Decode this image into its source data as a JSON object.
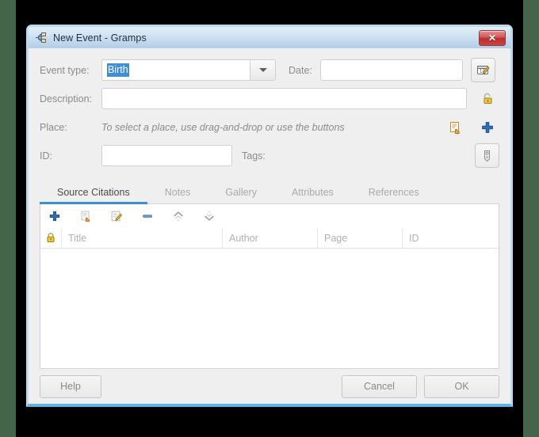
{
  "window": {
    "title": "New Event - Gramps",
    "app_icon": "gramps-family-tree-icon",
    "close_label": "✕"
  },
  "form": {
    "event_type": {
      "label": "Event type:",
      "value": "Birth",
      "selected": true,
      "dropdown_icon": "chevron-down-icon"
    },
    "date": {
      "label": "Date:",
      "value": "",
      "editor_icon": "calendar-edit-icon"
    },
    "description": {
      "label": "Description:",
      "value": "",
      "privacy_icon": "padlock-open-icon"
    },
    "place": {
      "label": "Place:",
      "hint": "To select a place, use drag-and-drop or use the buttons",
      "share_icon": "share-place-icon",
      "add_icon": "plus-icon"
    },
    "id": {
      "label": "ID:",
      "value": ""
    },
    "tags": {
      "label": "Tags:",
      "icon": "tag-icon"
    }
  },
  "notebook": {
    "tabs": [
      {
        "label": "Source Citations",
        "active": true
      },
      {
        "label": "Notes",
        "active": false
      },
      {
        "label": "Gallery",
        "active": false
      },
      {
        "label": "Attributes",
        "active": false
      },
      {
        "label": "References",
        "active": false
      }
    ],
    "toolbar": [
      {
        "name": "add-citation-icon",
        "glyph": "plus"
      },
      {
        "name": "share-citation-icon",
        "glyph": "share"
      },
      {
        "name": "edit-citation-icon",
        "glyph": "edit"
      },
      {
        "name": "remove-citation-icon",
        "glyph": "minus"
      },
      {
        "name": "move-up-icon",
        "glyph": "up"
      },
      {
        "name": "move-down-icon",
        "glyph": "down"
      }
    ],
    "columns": [
      {
        "label": "",
        "icon": "padlock-icon"
      },
      {
        "label": "Title"
      },
      {
        "label": "Author"
      },
      {
        "label": "Page"
      },
      {
        "label": "ID"
      }
    ],
    "rows": []
  },
  "actions": {
    "help": "Help",
    "cancel": "Cancel",
    "ok": "OK"
  },
  "colors": {
    "accent": "#3b8fd4",
    "selection": "#3d8fd8",
    "titlebar_top": "#e2eef8",
    "titlebar_bottom": "#b2cee6",
    "dialog_bg": "#efefef",
    "close_red": "#b92d2d",
    "desktop_strip": "#44654a"
  }
}
